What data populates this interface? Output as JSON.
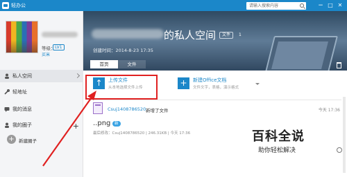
{
  "window": {
    "title": "轻办公",
    "search_placeholder": "请输入搜索内容",
    "min_label": "−",
    "max_label": "□",
    "close_label": "✕"
  },
  "user": {
    "level_label": "等级：",
    "level_value": "LV1",
    "extra": "买米"
  },
  "sidebar": {
    "items": [
      {
        "label": "私人空间",
        "icon": "person-icon"
      },
      {
        "label": "轻地址",
        "icon": "link-icon"
      },
      {
        "label": "我的消息",
        "icon": "chat-icon"
      },
      {
        "label": "我的圈子",
        "icon": "group-icon"
      }
    ],
    "new_circle_label": "新建圈子",
    "new_circle_symbol": "+",
    "add_symbol": "+"
  },
  "banner": {
    "title": "的私人空间",
    "files_label": "文件",
    "files_count": "1",
    "created": "创建时间：2014-8-23 17:35"
  },
  "tabs": [
    {
      "label": "首页"
    },
    {
      "label": "文件"
    }
  ],
  "toolbar": {
    "upload": {
      "title": "上传文件",
      "subtitle": "从本地选择文件上传",
      "symbol": "↑"
    },
    "new_doc": {
      "title": "新建Office文档",
      "subtitle": "文件文字，表格，演示格式",
      "symbol": "+"
    }
  },
  "feed": {
    "actor": "Csuj1408786520",
    "action": "新增了文件",
    "time": "今天 17:36",
    "filename": "..png",
    "new_badge": "新",
    "file_info": "最后修改：Csuj1408786520 | 246.31KB | 今天 17:36"
  },
  "watermark": {
    "title": "百科全说",
    "subtitle": "助你轻松解决"
  },
  "colors": {
    "accent": "#1b87c9",
    "highlight": "#e02020"
  }
}
